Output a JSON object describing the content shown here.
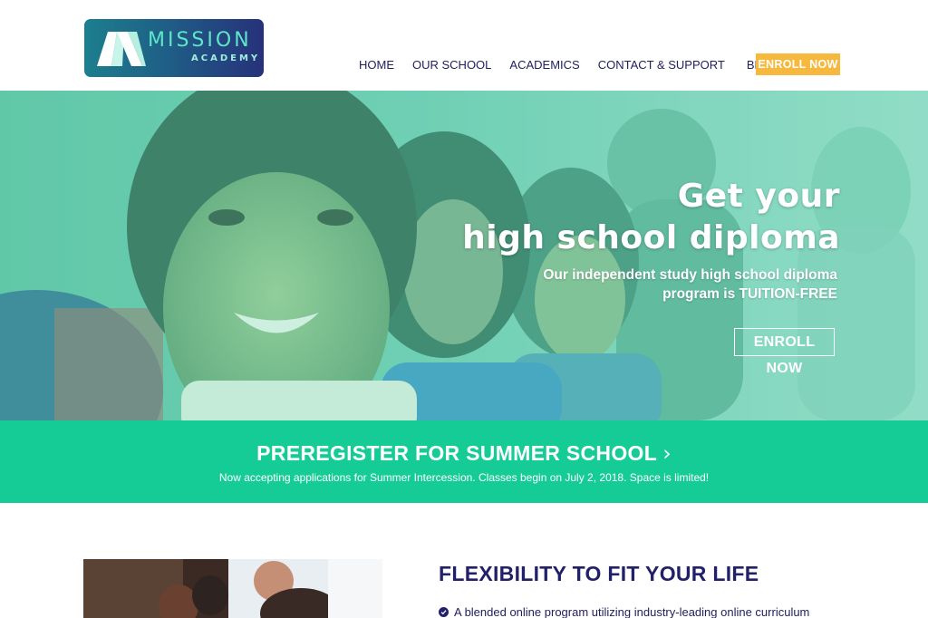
{
  "brand": {
    "name": "MISSION",
    "sub": "ACADEMY",
    "colors": {
      "navy": "#22206a",
      "mint": "#16cc96",
      "gold": "#f6b83d"
    }
  },
  "nav": {
    "items": [
      {
        "label": "HOME"
      },
      {
        "label": "OUR SCHOOL"
      },
      {
        "label": "ACADEMICS"
      },
      {
        "label": "CONTACT & SUPPORT"
      },
      {
        "label": "BLOG"
      }
    ],
    "cta": "ENROLL NOW"
  },
  "hero": {
    "title_line1": "Get your",
    "title_line2": "high school diploma",
    "subtitle_line1": "Our independent study high school diploma",
    "subtitle_line2": "program is TUITION-FREE",
    "cta": "ENROLL NOW"
  },
  "summer": {
    "title": "PREREGISTER FOR SUMMER SCHOOL",
    "chevron": "›",
    "text": "Now accepting applications for Summer Intercession. Classes begin on July 2, 2018. Space is limited!"
  },
  "features": {
    "title": "FLEXIBILITY TO FIT YOUR LIFE",
    "items": [
      {
        "label": "A blended online program utilizing industry-leading online curriculum",
        "icon": "check-circle-icon"
      }
    ]
  }
}
